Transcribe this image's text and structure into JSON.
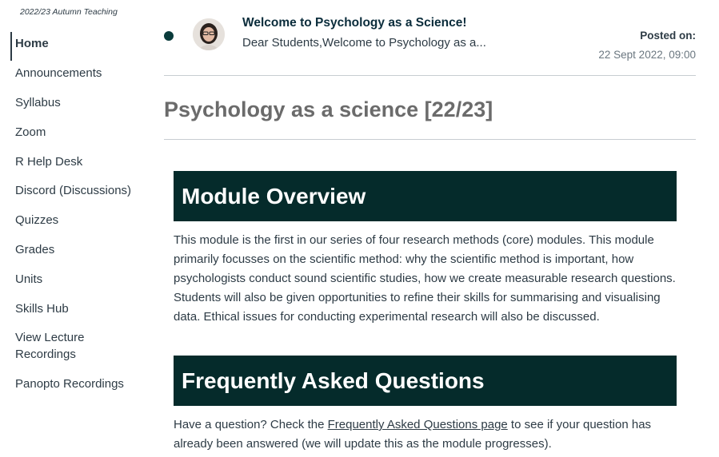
{
  "sidebar": {
    "term": "2022/23 Autumn Teaching",
    "items": [
      {
        "label": "Home",
        "active": true
      },
      {
        "label": "Announcements"
      },
      {
        "label": "Syllabus"
      },
      {
        "label": "Zoom"
      },
      {
        "label": "R Help Desk"
      },
      {
        "label": "Discord (Discussions)"
      },
      {
        "label": "Quizzes"
      },
      {
        "label": "Grades"
      },
      {
        "label": "Units"
      },
      {
        "label": "Skills Hub"
      },
      {
        "label": "View Lecture Recordings"
      },
      {
        "label": "Panopto Recordings"
      }
    ]
  },
  "announcement": {
    "title": "Welcome to Psychology as a Science!",
    "snippet": "Dear Students,Welcome to Psychology as a...",
    "posted_label": "Posted on:",
    "posted_date": "22 Sept 2022, 09:00",
    "unread_dot_color": "#0a3b3b"
  },
  "page": {
    "title": "Psychology as a science [22/23]"
  },
  "content": {
    "header_color": "#052b2b",
    "overview": {
      "heading": "Module Overview",
      "text": "This module is the first in our series of four research methods (core) modules. This module primarily focusses on the scientific method: why the scientific method is important, how psychologists conduct sound scientific studies, how we create measurable research questions. Students will also be given opportunities to refine their skills for summarising and visualising data. Ethical issues for conducting experimental research will also be discussed."
    },
    "faq": {
      "heading": "Frequently Asked Questions",
      "text_before": "Have a question? Check the ",
      "link": "Frequently Asked Questions page",
      "text_after": " to see if your question has already been answered (we will update this as the module progresses)."
    }
  }
}
